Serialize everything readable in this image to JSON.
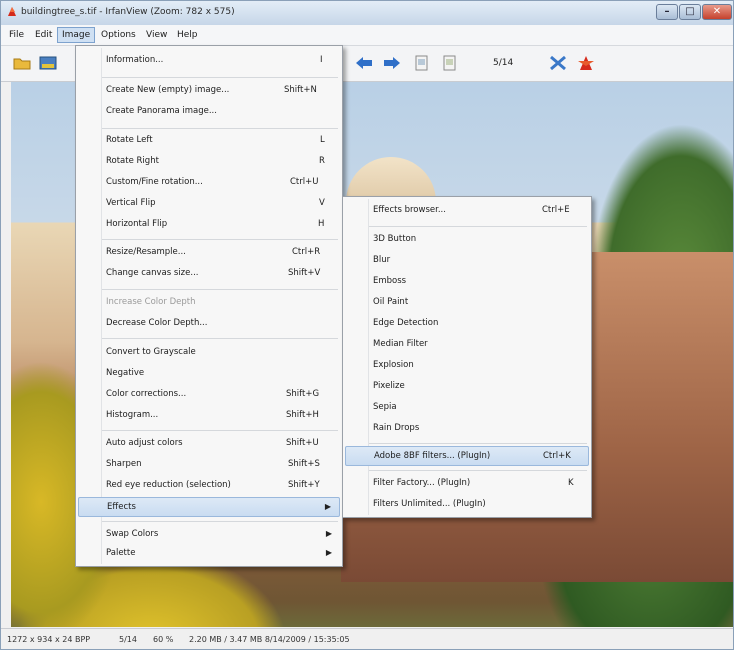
{
  "window": {
    "title": "buildingtree_s.tif - IrfanView (Zoom: 782 x 575)",
    "min_glyph": "–",
    "max_glyph": "□",
    "close_glyph": "✕"
  },
  "menubar": {
    "items": [
      "File",
      "Edit",
      "Image",
      "Options",
      "View",
      "Help"
    ]
  },
  "toolbar": {
    "page_counter": "5/14",
    "icons": [
      "open-folder-icon",
      "thumbnails-icon",
      "back-arrow-icon",
      "forward-arrow-icon",
      "copy-icon",
      "paste-icon",
      "tools-icon",
      "irfanview-logo-icon"
    ]
  },
  "image_menu": {
    "items": [
      {
        "label": "Information...",
        "shortcut": "I"
      },
      {
        "label": "Create New (empty) image...",
        "shortcut": "Shift+N"
      },
      {
        "label": "Create Panorama image...",
        "shortcut": ""
      },
      {
        "label": "Rotate Left",
        "shortcut": "L"
      },
      {
        "label": "Rotate Right",
        "shortcut": "R"
      },
      {
        "label": "Custom/Fine rotation...",
        "shortcut": "Ctrl+U"
      },
      {
        "label": "Vertical Flip",
        "shortcut": "V"
      },
      {
        "label": "Horizontal Flip",
        "shortcut": "H"
      },
      {
        "label": "Resize/Resample...",
        "shortcut": "Ctrl+R"
      },
      {
        "label": "Change canvas size...",
        "shortcut": "Shift+V"
      },
      {
        "label": "Increase Color Depth",
        "shortcut": ""
      },
      {
        "label": "Decrease Color Depth...",
        "shortcut": ""
      },
      {
        "label": "Convert to Grayscale",
        "shortcut": ""
      },
      {
        "label": "Negative",
        "shortcut": ""
      },
      {
        "label": "Color corrections...",
        "shortcut": "Shift+G"
      },
      {
        "label": "Histogram...",
        "shortcut": "Shift+H"
      },
      {
        "label": "Auto adjust colors",
        "shortcut": "Shift+U"
      },
      {
        "label": "Sharpen",
        "shortcut": "Shift+S"
      },
      {
        "label": "Red eye reduction (selection)",
        "shortcut": "Shift+Y"
      },
      {
        "label": "Effects",
        "shortcut": ""
      },
      {
        "label": "Swap Colors",
        "shortcut": ""
      },
      {
        "label": "Palette",
        "shortcut": ""
      }
    ],
    "submenu_arrow": "▶"
  },
  "effects_menu": {
    "items": [
      {
        "label": "Effects browser...",
        "shortcut": "Ctrl+E"
      },
      {
        "label": "3D Button",
        "shortcut": ""
      },
      {
        "label": "Blur",
        "shortcut": ""
      },
      {
        "label": "Emboss",
        "shortcut": ""
      },
      {
        "label": "Oil Paint",
        "shortcut": ""
      },
      {
        "label": "Edge Detection",
        "shortcut": ""
      },
      {
        "label": "Median Filter",
        "shortcut": ""
      },
      {
        "label": "Explosion",
        "shortcut": ""
      },
      {
        "label": "Pixelize",
        "shortcut": ""
      },
      {
        "label": "Sepia",
        "shortcut": ""
      },
      {
        "label": "Rain Drops",
        "shortcut": ""
      },
      {
        "label": "Adobe 8BF filters... (PlugIn)",
        "shortcut": "Ctrl+K"
      },
      {
        "label": "Filter Factory... (PlugIn)",
        "shortcut": "K"
      },
      {
        "label": "Filters Unlimited... (PlugIn)",
        "shortcut": ""
      }
    ]
  },
  "statusbar": {
    "dimensions": "1272 x 934 x 24 BPP",
    "page": "5/14",
    "zoom": "60 %",
    "file_info": "2.20 MB / 3.47 MB  8/14/2009 / 15:35:05"
  },
  "colors": {
    "menu_highlight": "#c9dcf1",
    "close_button": "#c5412d"
  }
}
